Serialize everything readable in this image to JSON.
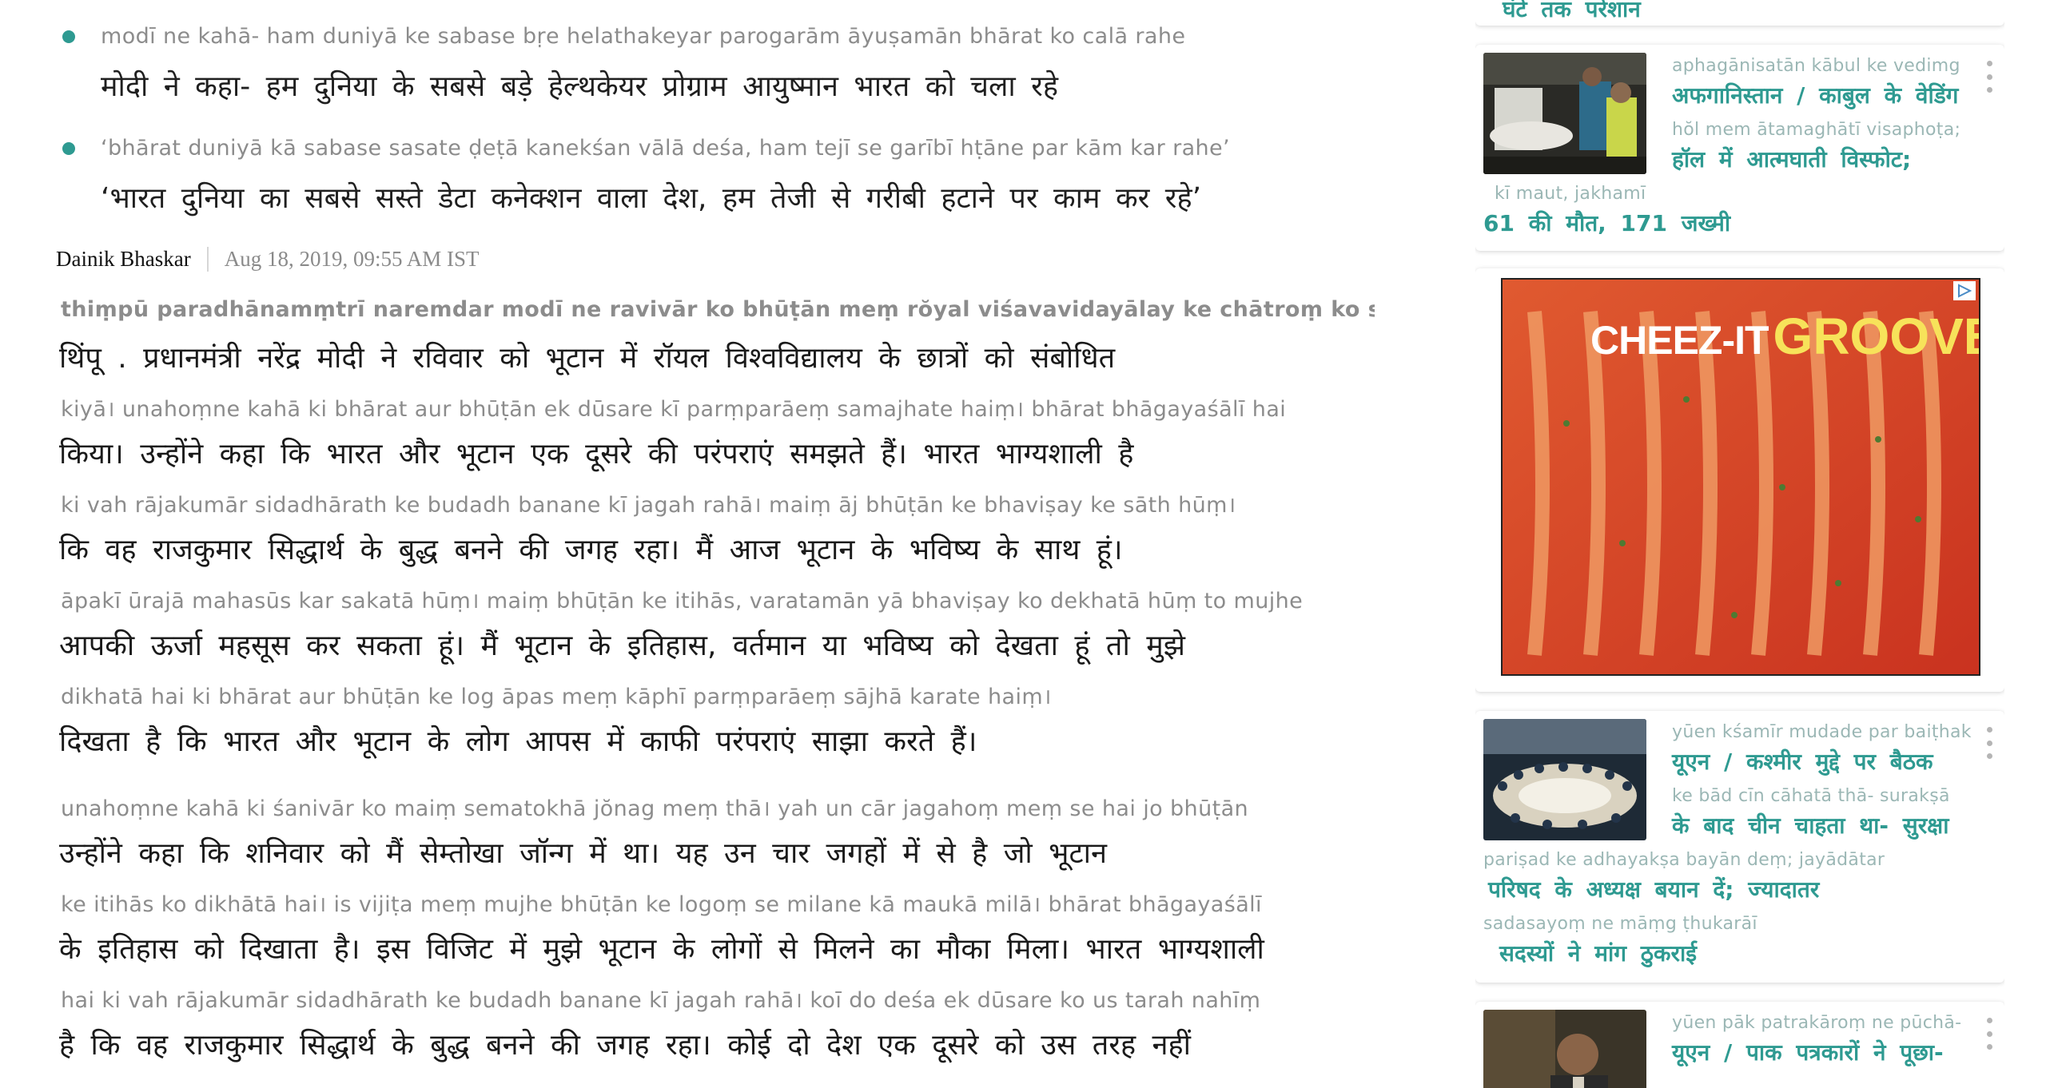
{
  "highlights": [
    {
      "roman": "modī  ne  kahā-  ham  duniyā  ke  sabase  bṛe  helathakeyar  parogarām  āyuṣamān  bhārat   ko  calā   rahe",
      "devanagari": "मोदी ने कहा- हम दुनिया के सबसे बड़े हेल्थकेयर   प्रोग्राम   आयुष्मान भारत को चला रहे"
    },
    {
      "roman": "‘bhārat  duniyā  kā  sabase  sasate  ḍeṭā  kanekśan  vālā  deśa,  ham   tejī   se  garībī  hṭāne  par  kām   kar  rahe’",
      "devanagari": "‘भारत दुनिया का सबसे  सस्ते  डेटा कनेक्शन वाला देश,  हम तेजी से गरीबी हटाने पर काम कर  रहे’"
    }
  ],
  "byline": {
    "source": "Dainik Bhaskar",
    "date": "Aug 18, 2019, 09:55 AM IST"
  },
  "paragraphs": [
    {
      "lines": [
        {
          "roman": "thiṃpū   paradhānamṃtrī  naremdar  modī  ne  ravivār  ko  bhūṭān  meṃ  rŏyal  viśavavidayālay  ke  chātroṃ  ko  sṃbodhit",
          "devanagari": "थिंपू .    प्रधानमंत्री       नरेंद्र   मोदी ने रविवार को भूटान   में  रॉयल   विश्वविद्यालय   के   छात्रों   को संबोधित"
        },
        {
          "roman": "kiyā।   unahoṃne  kahā   ki   bhārat  aur  bhūṭān   ek   dūsare  kī   parṃparāeṃ  samajhate  haiṃ।  bhārat  bhāgayaśālī  hai",
          "devanagari": "किया।   उन्होंने   कहा कि भारत और भूटान एक दूसरे  की    परंपराएं     समझते    हैं।   भारत भाग्यशाली  है"
        },
        {
          "roman": " ki   vah  rājakumār  sidadhārath  ke  budadh  banane   kī   jagah  rahā।  maiṃ    āj    bhūṭān  ke  bhaviṣay  ke  sāth  hūṃ।",
          "devanagari": "कि वह राजकुमार   सिद्धार्थ    के   बुद्ध    बनने  की जगह रहा।   मैं   आज  भूटान  के   भविष्य  के साथ  हूं।"
        },
        {
          "roman": " āpakī  ūrajā  mahasūs  kar  sakatā  hūṃ।  maiṃ  bhūṭān  ke   itihās,    varatamān  yā  bhaviṣay  ko  dekhatā  hūṃ  to  mujhe",
          "devanagari": "आपकी ऊर्जा  महसूस  कर सकता    हूं। मैं    भूटान के इतिहास,   वर्तमान   या  भविष्य   को  देखता   हूं  तो  मुझे"
        },
        {
          "roman": "dikhatā  hai   ki   bhārat  aur  bhūṭān  ke   log    āpas   meṃ   kāphī   parṃparāeṃ  sājhā  karate  haiṃ।",
          "devanagari": "दिखता  है  कि  भारत  और  भूटान  के लोग आपस   में    काफी    परंपराएं     साझा  करते   हैं।"
        }
      ]
    },
    {
      "lines": [
        {
          "roman": "unahoṃne  kahā   ki  śanivār   ko   maiṃ  sematokhā  jŏnag  meṃ  thā।  yah  un   cār  jagahoṃ  meṃ  se  hai  jo  bhūṭān",
          "devanagari": "  उन्होंने    कहा कि शनिवार को    मैं     सेम्तोखा   जॉन्ग    में   था। यह उन चार   जगहों     में   से  है  जो भूटान"
        },
        {
          "roman": "  ke  itihās    ko  dikhātā  hai।   is     vijiṭa    meṃ  mujhe  bhūṭān  ke  logoṃ  se  milane  kā  maukā  milā।  bhārat  bhāgayaśālī",
          "devanagari": "के इतिहास को दिखाता है।  इस विजिट    में    मुझे    भूटान  के  लोगों  से मिलने  का मौका मिला।  भारत  भाग्यशाली"
        },
        {
          "roman": "hai   ki   vah  rājakumār  sidadhārath  ke  budadh  banane   kī  jagah  rahā।   koī   do  deśa   ek   dūsare  ko   us   tarah  nahīṃ",
          "devanagari": "है  कि वह राजकुमार    सिद्धार्थ     के    बुद्ध    बनने   की जगह रहा।  कोई दो  देश  एक  दूसरे   को उस तरह    नहीं"
        }
      ]
    }
  ],
  "sidebar": {
    "top_card_line": "घंटे   तक  परेशान",
    "news": [
      {
        "lines": [
          {
            "roman": "aphagānisatān    kābul   ke  vedimg",
            "devanagari": "अफगानिस्तान / काबुल  के  वेडिंग"
          },
          {
            "roman": "hŏl   mem  ātamaghātī  visaphoṭa;",
            "devanagari": "हॉल   में   आत्मघाती   विस्फोट;"
          },
          {
            "roman": "kī   maut,       jakhamī",
            "devanagari": "61 की मौत, 171 जख्मी"
          }
        ]
      },
      {
        "lines": [
          {
            "roman": "yūen   kśamīr  mudade  par  baiṭhak",
            "devanagari": "यूएन / कश्मीर   मुद्दे   पर  बैठक"
          },
          {
            "roman": "ke  bād  cīn  cāhatā  thā-  surakṣā",
            "devanagari": "के बाद चीन चाहता था-   सुरक्षा"
          },
          {
            "roman": "pariṣad  ke  adhayakṣa  bayān  deṃ;  jayādātar",
            "devanagari": "परिषद  के   अध्यक्ष   बयान  दें;  ज्यादातर"
          },
          {
            "roman": "sadasayoṃ  ne  māṃg  ṭhukarāī",
            "devanagari": " सदस्यों    ने  मांग  ठुकराई"
          }
        ]
      },
      {
        "lines": [
          {
            "roman": "yūen   pāk  patrakāroṃ  ne  pūchā-",
            "devanagari": "यूएन / पाक   पत्रकारों    ने  पूछा-"
          }
        ]
      }
    ],
    "ad": {
      "brand_left": "CHEEZ-IT",
      "brand_right": "GROOVES",
      "ad_choices_icon": "ad-choices-icon"
    }
  },
  "colors": {
    "accent_teal": "#2e9a91",
    "roman_gray": "#8c8c8c",
    "sidebar_roman": "#9bb7b5",
    "ad_bg": "#d94a2c"
  }
}
